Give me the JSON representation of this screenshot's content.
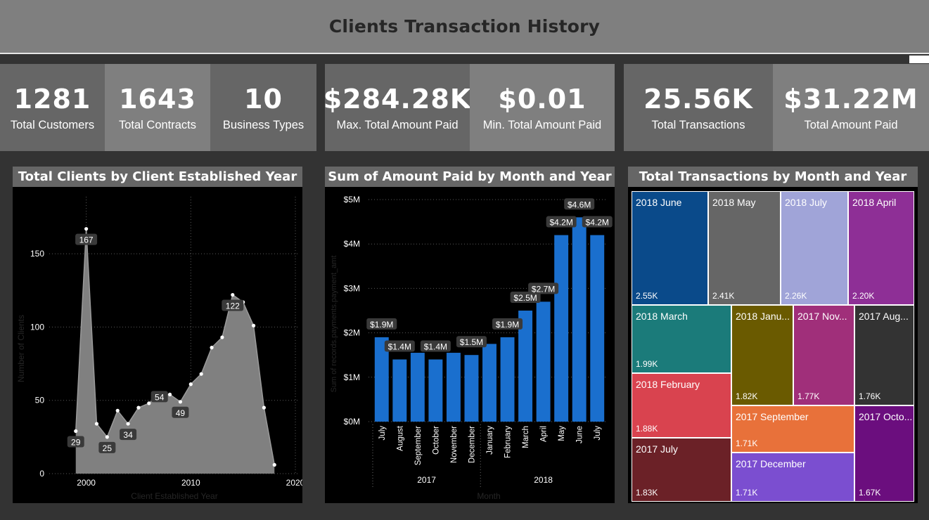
{
  "header": {
    "title": "Clients Transaction History"
  },
  "kpis": [
    {
      "value": "1281",
      "label": "Total Customers"
    },
    {
      "value": "1643",
      "label": "Total Contracts"
    },
    {
      "value": "10",
      "label": "Business Types"
    },
    {
      "value": "$284.28K",
      "label": "Max. Total Amount Paid"
    },
    {
      "value": "$0.01",
      "label": "Min. Total Amount Paid"
    },
    {
      "value": "25.56K",
      "label": "Total Transactions"
    },
    {
      "value": "$31.22M",
      "label": "Total Amount Paid"
    }
  ],
  "colors": {
    "background": "#333333",
    "header": "#7f7f7f",
    "area_fill": "#808080",
    "bar": "#1a6fce",
    "treemap": [
      "#0a4a8a",
      "#666666",
      "#a0a4d8",
      "#8e2f96",
      "#1b7b7a",
      "#6a5a00",
      "#a02f7a",
      "#333333",
      "#d9434f",
      "#e8713a",
      "#6b0e7e",
      "#6b2127",
      "#7b4ed0"
    ]
  },
  "chart_data": [
    {
      "type": "area",
      "title": "Total Clients by Client Established Year",
      "xlabel": "Client Established Year",
      "ylabel": "Number of Clients",
      "x": [
        1999,
        2000,
        2001,
        2002,
        2003,
        2004,
        2005,
        2006,
        2007,
        2008,
        2009,
        2010,
        2011,
        2012,
        2013,
        2014,
        2015,
        2016,
        2017,
        2018
      ],
      "values": [
        29,
        167,
        34,
        25,
        43,
        34,
        45,
        48,
        54,
        54,
        49,
        61,
        68,
        86,
        93,
        122,
        117,
        101,
        45,
        6
      ],
      "point_labels": [
        {
          "index": 0,
          "text": "29"
        },
        {
          "index": 1,
          "text": "167"
        },
        {
          "index": 3,
          "text": "25"
        },
        {
          "index": 5,
          "text": "34"
        },
        {
          "index": 8,
          "text": "54"
        },
        {
          "index": 10,
          "text": "49"
        },
        {
          "index": 15,
          "text": "122"
        }
      ],
      "xticks": [
        "2000",
        "2010",
        "2020"
      ],
      "yticks": [
        "0",
        "50",
        "100",
        "150"
      ],
      "xlim": [
        1997,
        2020
      ],
      "ylim": [
        0,
        175
      ]
    },
    {
      "type": "bar",
      "title": "Sum of Amount Paid by Month and Year",
      "xlabel": "Month",
      "ylabel": "Sum of records.payments.payment_amt",
      "categories": [
        "July",
        "August",
        "September",
        "October",
        "November",
        "December",
        "January",
        "February",
        "March",
        "April",
        "May",
        "June",
        "July"
      ],
      "groups": [
        {
          "name": "2017",
          "start": 0,
          "end": 5
        },
        {
          "name": "2018",
          "start": 6,
          "end": 12
        }
      ],
      "values": [
        1.9,
        1.4,
        1.55,
        1.4,
        1.55,
        1.5,
        1.75,
        1.9,
        2.5,
        2.7,
        4.2,
        4.6,
        4.2
      ],
      "data_labels": [
        {
          "index": 0,
          "text": "$1.9M"
        },
        {
          "index": 1,
          "text": "$1.4M"
        },
        {
          "index": 3,
          "text": "$1.4M"
        },
        {
          "index": 5,
          "text": "$1.5M"
        },
        {
          "index": 7,
          "text": "$1.9M"
        },
        {
          "index": 8,
          "text": "$2.5M"
        },
        {
          "index": 9,
          "text": "$2.7M"
        },
        {
          "index": 10,
          "text": "$4.2M"
        },
        {
          "index": 11,
          "text": "$4.6M"
        },
        {
          "index": 12,
          "text": "$4.2M"
        }
      ],
      "yticks": [
        "$0M",
        "$1M",
        "$2M",
        "$3M",
        "$4M",
        "$5M"
      ],
      "ylim": [
        0,
        5
      ],
      "unit": "M"
    },
    {
      "type": "treemap",
      "title": "Total Transactions by Month and Year",
      "items": [
        {
          "label": "2018 June",
          "value": "2.55K"
        },
        {
          "label": "2018 May",
          "value": "2.41K"
        },
        {
          "label": "2018 July",
          "value": "2.26K"
        },
        {
          "label": "2018 April",
          "value": "2.20K"
        },
        {
          "label": "2018 March",
          "value": "1.99K"
        },
        {
          "label": "2018 Janu...",
          "value": "1.82K"
        },
        {
          "label": "2017 Nov...",
          "value": "1.77K"
        },
        {
          "label": "2017 Aug...",
          "value": "1.76K"
        },
        {
          "label": "2018 February",
          "value": "1.88K"
        },
        {
          "label": "2017 September",
          "value": "1.71K"
        },
        {
          "label": "2017 Octo...",
          "value": "1.67K"
        },
        {
          "label": "2017 July",
          "value": "1.83K"
        },
        {
          "label": "2017 December",
          "value": "1.71K"
        }
      ]
    }
  ]
}
